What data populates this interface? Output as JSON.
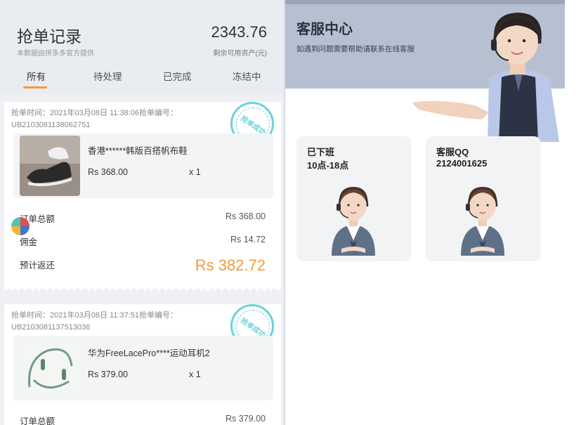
{
  "orders_panel": {
    "title": "抢单记录",
    "subtitle": "本数据由拼多多官方提供",
    "balance": "2343.76",
    "balance_label": "剩余可用资产(元)",
    "tabs": [
      "所有",
      "待处理",
      "已完成",
      "冻结中"
    ],
    "active_tab": "所有",
    "accent_color": "#f39a3b",
    "orders": [
      {
        "meta_line": "抢单时间：2021年03月08日 11:38:06抢单编号：",
        "order_no": "UB2103081138062751",
        "stamp": "抢单成功",
        "product": "香港******韩版百搭帆布鞋",
        "price": "Rs 368.00",
        "qty": "x 1",
        "total_label": "订单总额",
        "total": "Rs 368.00",
        "commission_label": "佣金",
        "commission": "Rs 14.72",
        "refund_label": "预计返还",
        "refund": "Rs 382.72"
      },
      {
        "meta_line": "抢单时间：2021年03月08日 11:37:51抢单编号：",
        "order_no": "UB2103081137513036",
        "stamp": "抢单成功",
        "product": "华为FreeLacePro****运动耳机2",
        "price": "Rs 379.00",
        "qty": "x 1",
        "total_label": "订单总额",
        "total": "Rs 379.00"
      }
    ]
  },
  "service_panel": {
    "title": "客服中心",
    "subtitle": "如遇到问题需要帮助请联系在线客服",
    "cards": [
      {
        "title": "已下班",
        "value": "10点-18点"
      },
      {
        "title": "客服QQ",
        "value": "2124001625"
      }
    ]
  }
}
